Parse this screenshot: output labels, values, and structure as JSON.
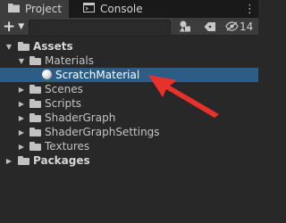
{
  "tabs": [
    {
      "label": "Project",
      "icon": "folder-icon"
    },
    {
      "label": "Console",
      "icon": "console-icon"
    }
  ],
  "toolbar": {
    "add_label": "+",
    "search_placeholder": "",
    "hidden_count": "14"
  },
  "tree": {
    "assets": "Assets",
    "materials": "Materials",
    "scratch_material": "ScratchMaterial",
    "scenes": "Scenes",
    "scripts": "Scripts",
    "shader_graph": "ShaderGraph",
    "shader_graph_settings": "ShaderGraphSettings",
    "textures": "Textures",
    "packages": "Packages"
  },
  "colors": {
    "selection": "#2c5d87",
    "annotation_arrow": "#e8312b"
  }
}
